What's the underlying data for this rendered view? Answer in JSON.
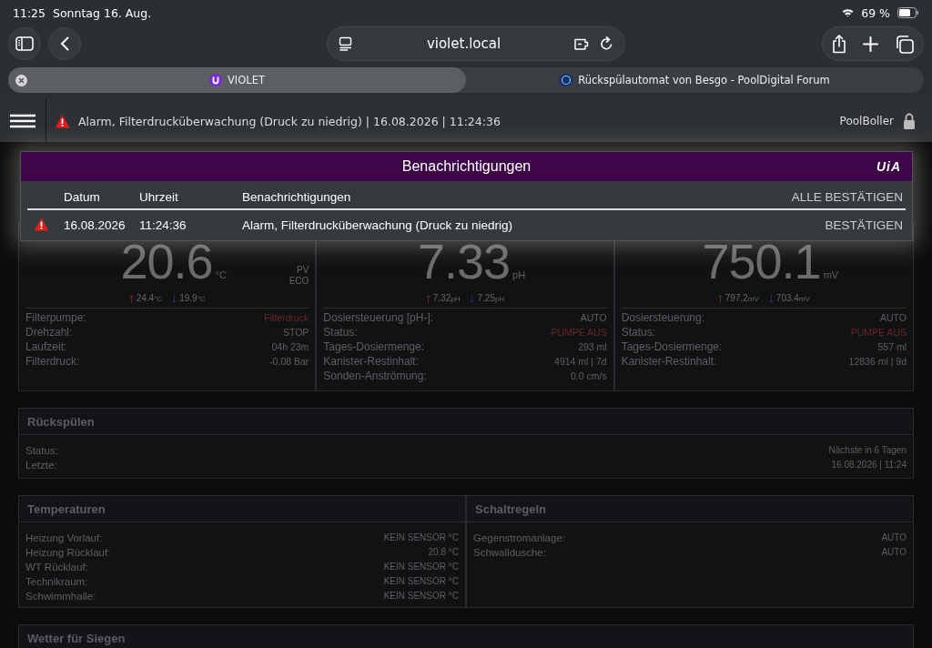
{
  "status_bar": {
    "time": "11:25",
    "date": "Sonntag 16. Aug.",
    "battery": "69 %"
  },
  "browser": {
    "url": "violet.local",
    "tabs": [
      {
        "label": "VIOLET",
        "selected": true
      },
      {
        "label": "Rückspülautomat von Besgo - PoolDigital Forum",
        "selected": false
      }
    ]
  },
  "app_header": {
    "alarm": "Alarm, Filterdrucküberwachung (Druck zu niedrig) | 16.08.2026 | 11:24:36",
    "user": "PoolBoller"
  },
  "gauges": [
    {
      "value": "20.6",
      "unit": "°C",
      "badges": [
        "PV",
        "ECO"
      ],
      "max": "24.4",
      "max_unit": "°C",
      "min": "19.9",
      "min_unit": "°C",
      "rows": [
        {
          "label": "Filterpumpe:",
          "value": "Filterdruck",
          "warning": true
        },
        {
          "label": "Drehzahl:",
          "value": "STOP",
          "warning": false
        },
        {
          "label": "Laufzeit:",
          "value": "04h 23m",
          "warning": false
        },
        {
          "label": "Filterdruck:",
          "value": "-0.08 Bar",
          "warning": false
        }
      ]
    },
    {
      "value": "7.33",
      "unit": "pH",
      "max": "7.32",
      "max_unit": "pH",
      "min": "7.25",
      "min_unit": "pH",
      "rows": [
        {
          "label": "Dosiersteuerung [pH-]:",
          "value": "AUTO",
          "warning": false
        },
        {
          "label": "Status:",
          "value": "PUMPE AUS",
          "warning": true
        },
        {
          "label": "Tages-Dosiermenge:",
          "value": "293 ml",
          "warning": false
        },
        {
          "label": "Kanister-Restinhalt:",
          "value": "4914 ml | 7d",
          "warning": false
        },
        {
          "label": "Sonden-Anströmung:",
          "value": "0.0 cm/s",
          "warning": false
        }
      ]
    },
    {
      "value": "750.1",
      "unit": "mV",
      "max": "797.2",
      "max_unit": "mV",
      "min": "703.4",
      "min_unit": "mV",
      "rows": [
        {
          "label": "Dosiersteuerung:",
          "value": "AUTO",
          "warning": false
        },
        {
          "label": "Status:",
          "value": "PUMPE AUS",
          "warning": true
        },
        {
          "label": "Tages-Dosiermenge:",
          "value": "557 ml",
          "warning": false
        },
        {
          "label": "Kanister-Restinhalt:",
          "value": "12836 ml | 9d",
          "warning": false
        }
      ]
    }
  ],
  "backwash": {
    "title": "Rückspülen",
    "rows": [
      {
        "label": "Status:",
        "value": "Nächste in 6 Tagen"
      },
      {
        "label": "Letzte:",
        "value": "16.08.2026 | 11:24"
      }
    ]
  },
  "temperatures": {
    "title": "Temperaturen",
    "rows": [
      {
        "label": "Heizung Vorlauf:",
        "value": "KEIN SENSOR °C"
      },
      {
        "label": "Heizung Rücklauf:",
        "value": "20.8 °C"
      },
      {
        "label": "WT Rücklauf:",
        "value": "KEIN SENSOR °C"
      },
      {
        "label": "Technikraum:",
        "value": "KEIN SENSOR °C"
      },
      {
        "label": "Schwimmhalle:",
        "value": "KEIN SENSOR °C"
      }
    ]
  },
  "switch_rules": {
    "title": "Schaltregeln",
    "rows": [
      {
        "label": "Gegenstromanlage:",
        "value": "AUTO"
      },
      {
        "label": "Schwalldusche:",
        "value": "AUTO"
      }
    ]
  },
  "weather": {
    "title": "Wetter für Siegen"
  },
  "notifications": {
    "title": "Benachrichtigungen",
    "logo": "UiA",
    "columns": [
      "Datum",
      "Uhrzeit",
      "Benachrichtigungen"
    ],
    "confirm_all": "ALLE BESTÄTIGEN",
    "rows": [
      {
        "date": "16.08.2026",
        "time": "11:24:36",
        "message": "Alarm, Filterdrucküberwachung (Druck zu niedrig)",
        "action": "BESTÄTIGEN"
      }
    ]
  }
}
